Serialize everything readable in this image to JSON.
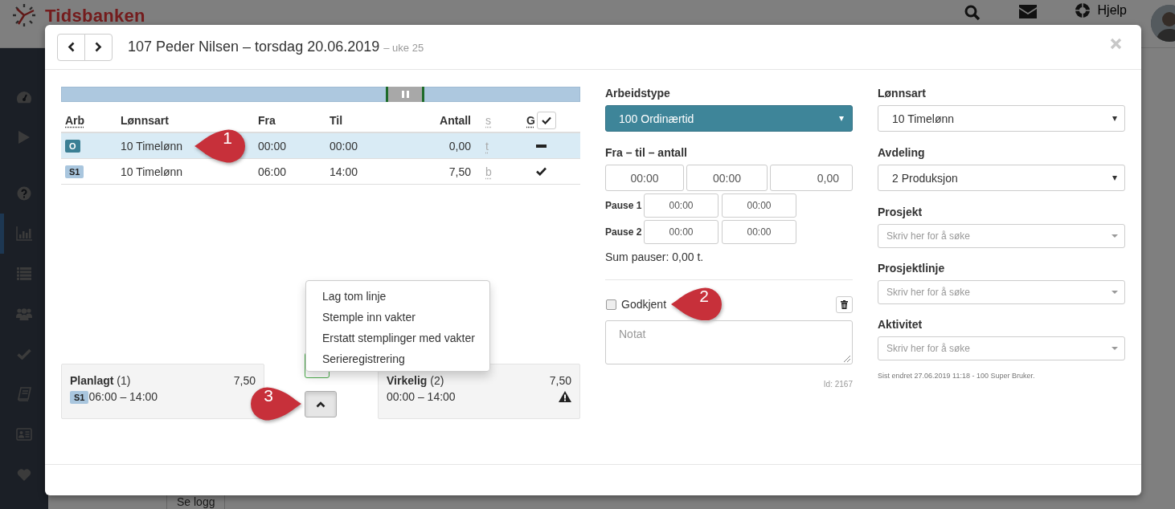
{
  "header": {
    "logo_text": "Tidsbanken",
    "help_label": "Hjelp"
  },
  "sidebar": {
    "items": [
      {
        "kind": "gauge",
        "selected": false
      },
      {
        "kind": "play",
        "selected": false
      },
      {
        "kind": "help",
        "selected": false
      },
      {
        "kind": "bar-chart",
        "selected": true
      },
      {
        "kind": "list",
        "selected": false
      },
      {
        "kind": "users",
        "selected": false
      },
      {
        "kind": "check",
        "selected": false
      },
      {
        "kind": "book",
        "selected": false
      },
      {
        "kind": "id-card",
        "selected": false
      },
      {
        "kind": "heart",
        "selected": false
      }
    ]
  },
  "page": {
    "log_button": "Se logg"
  },
  "modal": {
    "title": "107 Peder Nilsen – torsdag 20.06.2019",
    "subtitle": "– uke 25",
    "table": {
      "columns": [
        {
          "label": "Arb",
          "kind": "abbr"
        },
        {
          "label": "Lønnsart",
          "kind": "plain"
        },
        {
          "label": "Fra",
          "kind": "plain"
        },
        {
          "label": "Til",
          "kind": "plain"
        },
        {
          "label": "Antall",
          "kind": "number"
        },
        {
          "label": "s",
          "kind": "muted"
        },
        {
          "label": "G",
          "kind": "check-all"
        }
      ],
      "rows": [
        {
          "badge": "O",
          "color": "#3b7f94",
          "wage_type": "10 Timelønn",
          "from": "00:00",
          "to": "00:00",
          "amount": "0,00",
          "status": "t",
          "approved": false,
          "selected": true,
          "callout": "1"
        },
        {
          "badge": "S1",
          "color": "#a9c6de",
          "wage_type": "10 Timelønn",
          "from": "06:00",
          "to": "14:00",
          "amount": "7,50",
          "status": "b",
          "approved": true,
          "selected": false
        }
      ]
    },
    "summary": {
      "planned": {
        "label": "Planlagt",
        "count": "(1)",
        "total": "7,50",
        "badge": "S1",
        "time": "06:00 – 14:00",
        "warning": false
      },
      "actual": {
        "label": "Virkelig",
        "count": "(2)",
        "total": "7,50",
        "time": "00:00 – 14:00",
        "warning": true
      }
    },
    "action_menu": {
      "items": [
        "Lag tom linje",
        "Stemple inn vakter",
        "Erstatt stemplinger med vakter",
        "Serieregistrering"
      ]
    },
    "menu_toggle": {
      "callout": "3"
    },
    "form": {
      "work_type": {
        "label": "Arbeidstype",
        "value": "100 Ordinærtid"
      },
      "range": {
        "label": "Fra – til – antall",
        "from": "00:00",
        "to": "00:00",
        "amount": "0,00"
      },
      "pauses": [
        {
          "label": "Pause 1",
          "from": "00:00",
          "to": "00:00"
        },
        {
          "label": "Pause 2",
          "from": "00:00",
          "to": "00:00"
        }
      ],
      "pause_sum": "Sum pauser: 0,00 t.",
      "approved": {
        "label": "Godkjent",
        "checked": false,
        "callout": "2"
      },
      "note": {
        "placeholder": "Notat"
      },
      "id_text": "Id: 2167"
    },
    "side": {
      "selects": [
        {
          "label": "Lønnsart",
          "value": "10 Timelønn"
        },
        {
          "label": "Avdeling",
          "value": "2 Produksjon"
        }
      ],
      "searches": [
        {
          "label": "Prosjekt",
          "placeholder": "Skriv her for å søke"
        },
        {
          "label": "Prosjektlinje",
          "placeholder": "Skriv her for å søke"
        },
        {
          "label": "Aktivitet",
          "placeholder": "Skriv her for å søke"
        }
      ],
      "last_changed": "Sist endret 27.06.2019 11:18 - 100 Super Bruker."
    }
  }
}
